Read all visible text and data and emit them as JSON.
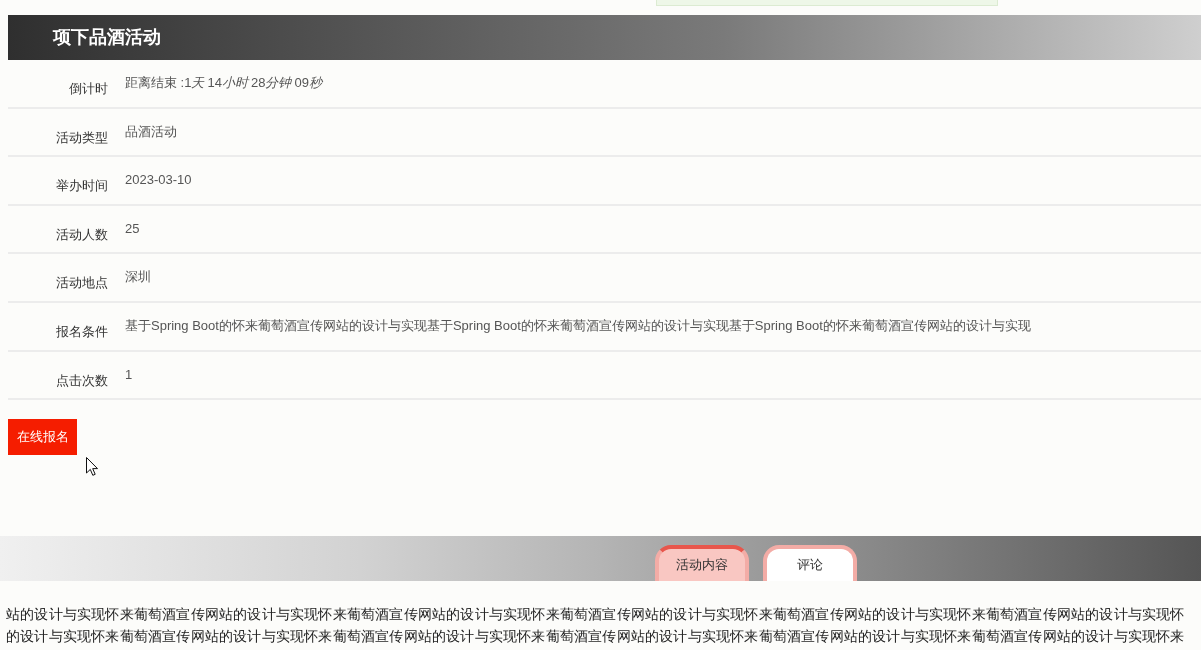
{
  "header": {
    "title": "项下品酒活动"
  },
  "details": [
    {
      "kind": "countdown",
      "label": "倒计时",
      "prefix": "距离结束 :",
      "parts": [
        {
          "number": "1",
          "unit": "天"
        },
        {
          "number": "14",
          "unit": "小时"
        },
        {
          "number": "28",
          "unit": "分钟"
        },
        {
          "number": "09",
          "unit": "秒"
        }
      ]
    },
    {
      "kind": "text",
      "label": "活动类型",
      "value": "品酒活动"
    },
    {
      "kind": "text",
      "label": "举办时间",
      "value": "2023-03-10"
    },
    {
      "kind": "text",
      "label": "活动人数",
      "value": "25"
    },
    {
      "kind": "text",
      "label": "活动地点",
      "value": "深圳"
    },
    {
      "kind": "text",
      "label": "报名条件",
      "value": "基于Spring Boot的怀来葡萄酒宣传网站的设计与实现基于Spring Boot的怀来葡萄酒宣传网站的设计与实现基于Spring Boot的怀来葡萄酒宣传网站的设计与实现"
    },
    {
      "kind": "text",
      "label": "点击次数",
      "value": "1"
    }
  ],
  "signup_button": {
    "label": "在线报名"
  },
  "tabs": [
    {
      "label": "活动内容",
      "selected": true
    },
    {
      "label": "评论",
      "selected": false
    }
  ],
  "content_lines": [
    "站的设计与实现怀来葡萄酒宣传网站的设计与实现怀来葡萄酒宣传网站的设计与实现怀来葡萄酒宣传网站的设计与实现怀来葡萄酒宣传网站的设计与实现怀来葡萄酒宣传网站的设计与实现怀",
    "的设计与实现怀来葡萄酒宣传网站的设计与实现怀来葡萄酒宣传网站的设计与实现怀来葡萄酒宣传网站的设计与实现怀来葡萄酒宣传网站的设计与实现怀来葡萄酒宣传网站的设计与实现怀来"
  ]
}
